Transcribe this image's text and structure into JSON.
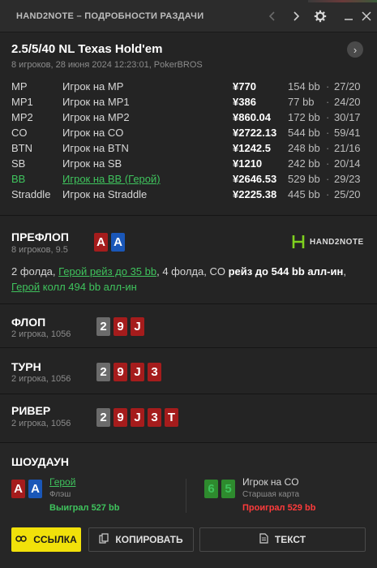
{
  "window": {
    "title": "HAND2NOTE – ПОДРОБНОСТИ РАЗДАЧИ",
    "icons": [
      "chevron-left-icon",
      "chevron-right-icon",
      "gear-icon",
      "minimize-icon",
      "close-icon"
    ]
  },
  "game": {
    "title": "2.5/5/40 NL Texas Hold'em",
    "subtitle": "8 игроков, 28 июня 2024 12:23:01, PokerBROS",
    "arrow": "›"
  },
  "players": [
    {
      "pos": "MP",
      "name": "Игрок на MP",
      "amount": "¥770",
      "bb": "154 bb",
      "dot": "·",
      "stat": "27/20",
      "hero": false
    },
    {
      "pos": "MP1",
      "name": "Игрок на MP1",
      "amount": "¥386",
      "bb": "77 bb",
      "dot": "·",
      "stat": "24/20",
      "hero": false
    },
    {
      "pos": "MP2",
      "name": "Игрок на MP2",
      "amount": "¥860.04",
      "bb": "172 bb",
      "dot": "·",
      "stat": "30/17",
      "hero": false
    },
    {
      "pos": "CO",
      "name": "Игрок на CO",
      "amount": "¥2722.13",
      "bb": "544 bb",
      "dot": "·",
      "stat": "59/41",
      "hero": false
    },
    {
      "pos": "BTN",
      "name": "Игрок на BTN",
      "amount": "¥1242.5",
      "bb": "248 bb",
      "dot": "·",
      "stat": "21/16",
      "hero": false
    },
    {
      "pos": "SB",
      "name": "Игрок на SB",
      "amount": "¥1210",
      "bb": "242 bb",
      "dot": "·",
      "stat": "20/14",
      "hero": false
    },
    {
      "pos": "BB",
      "name": "Игрок на BB (Герой)",
      "amount": "¥2646.53",
      "bb": "529 bb",
      "dot": "·",
      "stat": "29/23",
      "hero": true
    },
    {
      "pos": "Straddle",
      "name": "Игрок на Straddle",
      "amount": "¥2225.38",
      "bb": "445 bb",
      "dot": "·",
      "stat": "25/20",
      "hero": false
    }
  ],
  "preflop": {
    "title": "ПРЕФЛОП",
    "sub": "8 игроков, 9.5",
    "cards": [
      {
        "rank": "A",
        "suit": "red"
      },
      {
        "rank": "A",
        "suit": "blue"
      }
    ],
    "logo_text": "HAND2NOTE",
    "line1": {
      "a": "2 фолда, ",
      "b": "Герой рейз до 35 bb",
      "c": ", 4 фолда, CO ",
      "d": "рейз до 544 bb алл-ин",
      "e": ","
    },
    "line2": {
      "a": "Герой",
      "b": " колл 494 bb алл-ин"
    }
  },
  "flop": {
    "title": "ФЛОП",
    "sub": "2 игрока, 1056",
    "cards": [
      {
        "rank": "2",
        "suit": "gray"
      },
      {
        "rank": "9",
        "suit": "red"
      },
      {
        "rank": "J",
        "suit": "red"
      }
    ]
  },
  "turn": {
    "title": "ТУРН",
    "sub": "2 игрока, 1056",
    "cards": [
      {
        "rank": "2",
        "suit": "gray"
      },
      {
        "rank": "9",
        "suit": "red"
      },
      {
        "rank": "J",
        "suit": "red"
      },
      {
        "rank": "3",
        "suit": "red"
      }
    ]
  },
  "river": {
    "title": "РИВЕР",
    "sub": "2 игрока, 1056",
    "cards": [
      {
        "rank": "2",
        "suit": "gray"
      },
      {
        "rank": "9",
        "suit": "red"
      },
      {
        "rank": "J",
        "suit": "red"
      },
      {
        "rank": "3",
        "suit": "red"
      },
      {
        "rank": "T",
        "suit": "red"
      }
    ]
  },
  "showdown": {
    "title": "ШОУДАУН",
    "hero": {
      "cards": [
        {
          "rank": "A",
          "suit": "red"
        },
        {
          "rank": "A",
          "suit": "blue"
        }
      ],
      "name": "Герой",
      "hand": "Флэш",
      "result": "Выиграл 527 bb"
    },
    "villain": {
      "cards": [
        {
          "rank": "6",
          "suit": "green"
        },
        {
          "rank": "5",
          "suit": "green"
        }
      ],
      "name": "Игрок на CO",
      "hand": "Старшая карта",
      "result": "Проиграл 529 bb"
    }
  },
  "buttons": {
    "link": "ССЫЛКА",
    "copy": "КОПИРОВАТЬ",
    "text": "ТЕКСТ"
  },
  "colors": {
    "hero_green": "#3fc35d",
    "loss_red": "#ff3b3b",
    "link_yellow": "#f1e10a"
  }
}
